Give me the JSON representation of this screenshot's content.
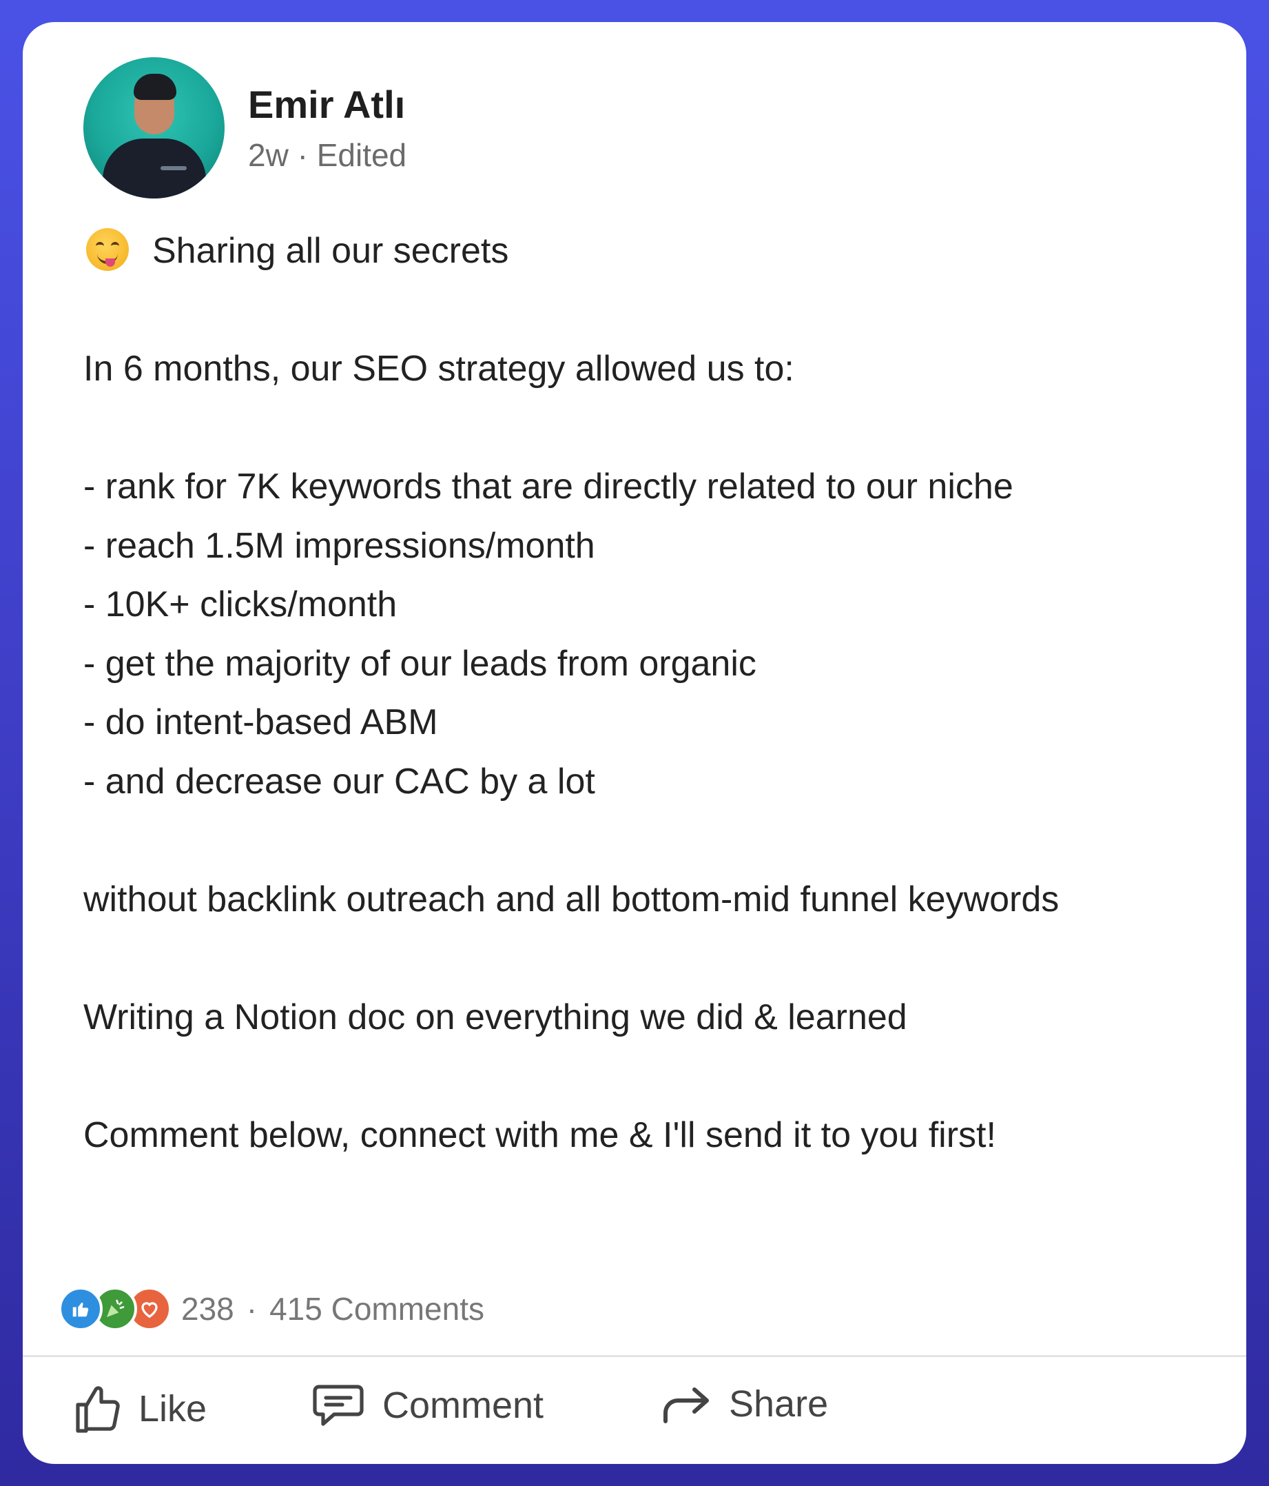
{
  "post": {
    "author": "Emir Atlı",
    "timestamp": "2w",
    "separator": "·",
    "edited": "Edited",
    "lines": [
      "Sharing all our secrets",
      "",
      "In 6 months, our SEO strategy allowed us to:",
      "",
      "- rank for 7K keywords that are directly related to our niche",
      "- reach 1.5M impressions/month",
      "- 10K+ clicks/month",
      "- get the majority of our leads from organic",
      "- do intent-based ABM",
      "- and decrease our CAC by a lot",
      "",
      "without backlink outreach and all bottom-mid funnel keywords",
      "",
      "Writing a Notion doc on everything we did & learned",
      "",
      "Comment below, connect with me & I'll send it to you first!"
    ]
  },
  "engagement": {
    "reaction_count": "238",
    "separator": "·",
    "comments": "415 Comments"
  },
  "actions": {
    "like": "Like",
    "comment": "Comment",
    "share": "Share"
  },
  "colors": {
    "frame": "#4a52e6",
    "like_reaction": "#2e8fe0",
    "celebrate_reaction": "#3f9a3a",
    "love_reaction": "#e8643f"
  }
}
